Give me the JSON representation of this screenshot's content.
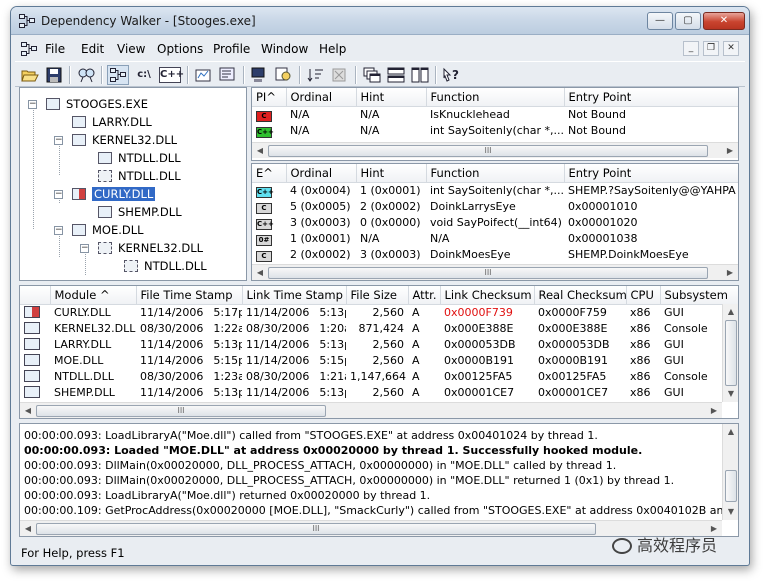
{
  "window": {
    "title": "Dependency Walker - [Stooges.exe]",
    "caption_buttons": {
      "minimize": "—",
      "maximize": "▢",
      "close": "✕"
    }
  },
  "menu": [
    "File",
    "Edit",
    "View",
    "Options",
    "Profile",
    "Window",
    "Help"
  ],
  "mdi_buttons": {
    "minimize": "_",
    "restore": "❐",
    "close": "✕"
  },
  "toolbar": {
    "buttons": [
      "open-icon",
      "save-icon",
      "find-icon",
      "module-tree-icon",
      "full-paths-icon",
      "cpp-undecorate-icon",
      "properties-icon",
      "system-info-icon",
      "view-module-icon",
      "highlight-match-icon",
      "sort-icon",
      "clear-icon",
      "cascade-icon",
      "tile-h-icon",
      "tile-v-icon",
      "help-icon"
    ],
    "labels": {
      "full_paths": "c:\\",
      "cpp": "C++"
    }
  },
  "tree": [
    {
      "label": "STOOGES.EXE",
      "depth": 0,
      "icon": "module-icon",
      "expander": "−"
    },
    {
      "label": "LARRY.DLL",
      "depth": 1,
      "icon": "module-icon",
      "expander": ""
    },
    {
      "label": "KERNEL32.DLL",
      "depth": 1,
      "icon": "module-icon",
      "expander": "−"
    },
    {
      "label": "NTDLL.DLL",
      "depth": 2,
      "icon": "module-icon",
      "expander": ""
    },
    {
      "label": "NTDLL.DLL",
      "depth": 2,
      "icon": "duplicate-module-icon",
      "expander": ""
    },
    {
      "label": "CURLY.DLL",
      "depth": 1,
      "icon": "error-module-icon",
      "expander": "−",
      "selected": true
    },
    {
      "label": "SHEMP.DLL",
      "depth": 2,
      "icon": "module-icon",
      "expander": ""
    },
    {
      "label": "MOE.DLL",
      "depth": 1,
      "icon": "dynamic-module-icon",
      "expander": "−"
    },
    {
      "label": "KERNEL32.DLL",
      "depth": 2,
      "icon": "duplicate-module-icon",
      "expander": "−"
    },
    {
      "label": "NTDLL.DLL",
      "depth": 3,
      "icon": "duplicate-module-icon",
      "expander": ""
    }
  ],
  "imports": {
    "headers": [
      "PI^",
      "Ordinal",
      "Hint",
      "Function",
      "Entry Point"
    ],
    "rows": [
      {
        "icon": "C",
        "color": "red",
        "ordinal": "N/A",
        "hint": "N/A",
        "function": "IsKnucklehead",
        "entry": "Not Bound"
      },
      {
        "icon": "C++",
        "color": "green",
        "ordinal": "N/A",
        "hint": "N/A",
        "function": "int SaySoitenly(char *,...)",
        "entry": "Not Bound"
      }
    ]
  },
  "exports": {
    "headers": [
      "E^",
      "Ordinal",
      "Hint",
      "Function",
      "Entry Point"
    ],
    "rows": [
      {
        "icon": "C++",
        "color": "cyan",
        "ordinal": "4 (0x0004)",
        "hint": "1 (0x0001)",
        "function": "int SaySoitenly(char *,...)",
        "entry": "SHEMP.?SaySoitenly@@YAHPA"
      },
      {
        "icon": "C",
        "color": "gray",
        "ordinal": "5 (0x0005)",
        "hint": "2 (0x0002)",
        "function": "DoinkLarrysEye",
        "entry": "0x00001010"
      },
      {
        "icon": "C++",
        "color": "gray",
        "ordinal": "3 (0x0003)",
        "hint": "0 (0x0000)",
        "function": "void SayPoifect(__int64)",
        "entry": "0x00001020"
      },
      {
        "icon": "0#",
        "color": "gray",
        "ordinal": "1 (0x0001)",
        "hint": "N/A",
        "function": "N/A",
        "entry": "0x00001038"
      },
      {
        "icon": "C",
        "color": "gray",
        "ordinal": "2 (0x0002)",
        "hint": "3 (0x0003)",
        "function": "DoinkMoesEye",
        "entry": "SHEMP.DoinkMoesEye"
      }
    ]
  },
  "modules": {
    "headers": [
      "",
      "Module ^",
      "File Time Stamp",
      "Link Time Stamp",
      "File Size",
      "Attr.",
      "Link Checksum",
      "Real Checksum",
      "CPU",
      "Subsystem"
    ],
    "rows": [
      {
        "icon": "error-module-icon",
        "module": "CURLY.DLL",
        "fdate": "11/14/2006",
        "ftime": "5:17p",
        "ldate": "11/14/2006",
        "ltime": "5:13p",
        "size": "2,560",
        "attr": "A",
        "link_ck": "0x0000F739",
        "link_ck_red": true,
        "real_ck": "0x0000F759",
        "cpu": "x86",
        "subsystem": "GUI"
      },
      {
        "icon": "module-icon",
        "module": "KERNEL32.DLL",
        "fdate": "08/30/2006",
        "ftime": "1:22a",
        "ldate": "08/30/2006",
        "ltime": "1:20a",
        "size": "871,424",
        "attr": "A",
        "link_ck": "0x000E388E",
        "link_ck_red": false,
        "real_ck": "0x000E388E",
        "cpu": "x86",
        "subsystem": "Console"
      },
      {
        "icon": "module-icon",
        "module": "LARRY.DLL",
        "fdate": "11/14/2006",
        "ftime": "5:13p",
        "ldate": "11/14/2006",
        "ltime": "5:13p",
        "size": "2,560",
        "attr": "A",
        "link_ck": "0x000053DB",
        "link_ck_red": false,
        "real_ck": "0x000053DB",
        "cpu": "x86",
        "subsystem": "GUI"
      },
      {
        "icon": "dynamic-module-icon",
        "module": "MOE.DLL",
        "fdate": "11/14/2006",
        "ftime": "5:15p",
        "ldate": "11/14/2006",
        "ltime": "5:15p",
        "size": "2,560",
        "attr": "A",
        "link_ck": "0x0000B191",
        "link_ck_red": false,
        "real_ck": "0x0000B191",
        "cpu": "x86",
        "subsystem": "GUI"
      },
      {
        "icon": "module-icon",
        "module": "NTDLL.DLL",
        "fdate": "08/30/2006",
        "ftime": "1:23a",
        "ldate": "08/30/2006",
        "ltime": "1:21a",
        "size": "1,147,664",
        "attr": "A",
        "link_ck": "0x00125FA5",
        "link_ck_red": false,
        "real_ck": "0x00125FA5",
        "cpu": "x86",
        "subsystem": "Console"
      },
      {
        "icon": "module-icon",
        "module": "SHEMP.DLL",
        "fdate": "11/14/2006",
        "ftime": "5:13p",
        "ldate": "11/14/2006",
        "ltime": "5:13p",
        "size": "2,560",
        "attr": "A",
        "link_ck": "0x00001CE7",
        "link_ck_red": false,
        "real_ck": "0x00001CE7",
        "cpu": "x86",
        "subsystem": "GUI"
      }
    ]
  },
  "log": [
    {
      "text": "00:00:00.093: LoadLibraryA(\"Moe.dll\") called from \"STOOGES.EXE\" at address 0x00401024 by thread 1.",
      "bold": false
    },
    {
      "text": "00:00:00.093: Loaded \"MOE.DLL\" at address 0x00020000 by thread 1.  Successfully hooked module.",
      "bold": true
    },
    {
      "text": "00:00:00.093: DllMain(0x00020000, DLL_PROCESS_ATTACH, 0x00000000) in \"MOE.DLL\" called by thread 1.",
      "bold": false
    },
    {
      "text": "00:00:00.093: DllMain(0x00020000, DLL_PROCESS_ATTACH, 0x00000000) in \"MOE.DLL\" returned 1 (0x1) by thread 1.",
      "bold": false
    },
    {
      "text": "00:00:00.093: LoadLibraryA(\"Moe.dll\") returned 0x00020000 by thread 1.",
      "bold": false
    },
    {
      "text": "00:00:00.109: GetProcAddress(0x00020000 [MOE.DLL], \"SmackCurly\") called from \"STOOGES.EXE\" at address 0x0040102B and returne",
      "bold": false
    }
  ],
  "status": {
    "text": "For Help, press F1"
  },
  "watermark": {
    "text": "高效程序员"
  },
  "scroll_thumb_glyph": "III"
}
